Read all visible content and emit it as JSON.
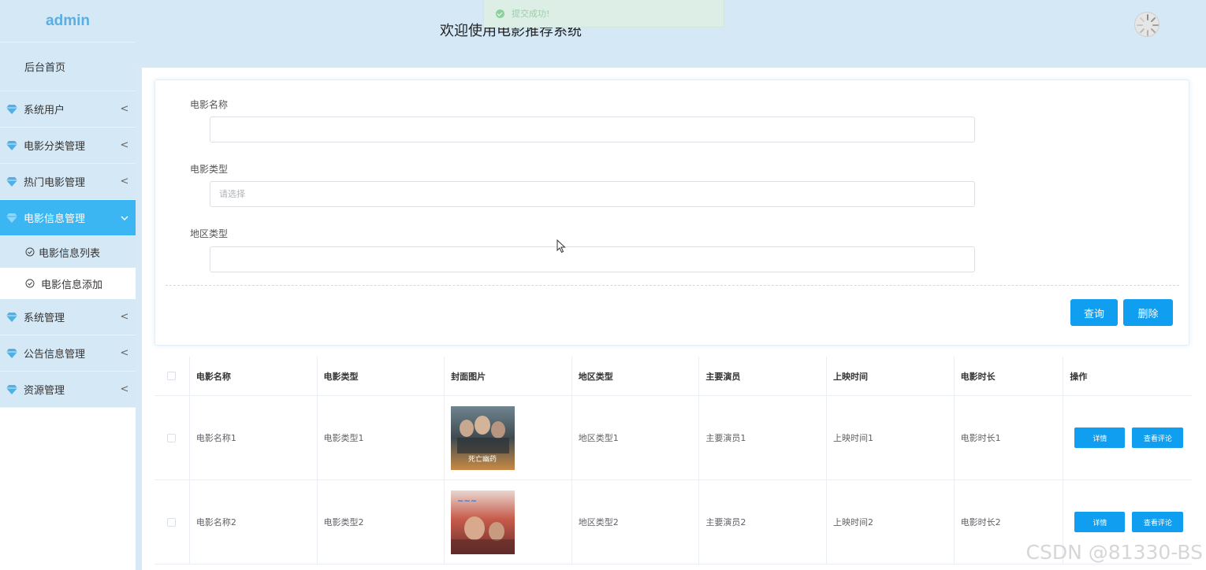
{
  "app": {
    "brand": "admin",
    "header_title": "欢迎使用电影推荐系统",
    "toast": "提交成功!"
  },
  "sidebar": {
    "home": "后台首页",
    "items": [
      {
        "label": "系统用户",
        "icon": "diamond-icon",
        "chevron": "<"
      },
      {
        "label": "电影分类管理",
        "icon": "diamond-icon",
        "chevron": "<"
      },
      {
        "label": "热门电影管理",
        "icon": "diamond-icon",
        "chevron": "<"
      },
      {
        "label": "电影信息管理",
        "icon": "diamond-icon",
        "chevron": "v",
        "active": true
      },
      {
        "label": "系统管理",
        "icon": "diamond-icon",
        "chevron": "<"
      },
      {
        "label": "公告信息管理",
        "icon": "diamond-icon",
        "chevron": "<"
      },
      {
        "label": "资源管理",
        "icon": "diamond-icon",
        "chevron": "<"
      }
    ],
    "sub_items": [
      {
        "label": "电影信息列表",
        "icon": "check-circle-icon"
      },
      {
        "label": "电影信息添加",
        "icon": "check-circle-icon",
        "current": true
      }
    ]
  },
  "search": {
    "movie_name_label": "电影名称",
    "movie_name_value": "",
    "movie_type_label": "电影类型",
    "movie_type_placeholder": "请选择",
    "region_label": "地区类型",
    "region_value": "",
    "query_button": "查询",
    "delete_button": "删除"
  },
  "table": {
    "headers": [
      "电影名称",
      "电影类型",
      "封面图片",
      "地区类型",
      "主要演员",
      "上映时间",
      "电影时长",
      "操作"
    ],
    "rows": [
      {
        "name": "电影名称1",
        "type": "电影类型1",
        "poster_text": "死亡幽药",
        "region": "地区类型1",
        "actors": "主要演员1",
        "release": "上映时间1",
        "duration": "电影时长1"
      },
      {
        "name": "电影名称2",
        "type": "电影类型2",
        "poster_text": "",
        "region": "地区类型2",
        "actors": "主要演员2",
        "release": "上映时间2",
        "duration": "电影时长2"
      }
    ],
    "detail_button": "详情",
    "comment_button": "查看评论"
  },
  "watermark": "CSDN @81330-BS",
  "colors": {
    "accent": "#0f9ef0",
    "sidebar_active": "#3bb6f2",
    "header_bg": "#d4e8f5",
    "brand": "#5aaee0"
  }
}
